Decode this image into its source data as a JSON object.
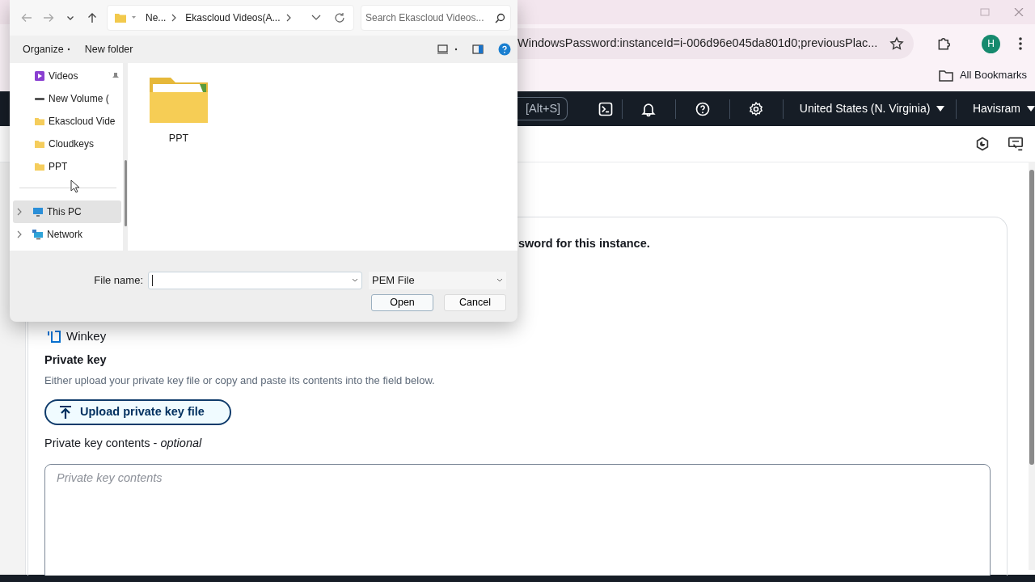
{
  "browser": {
    "address": "WindowsPassword:instanceId=i-006d96e045da801d0;previousPlac...",
    "profile_initial": "H",
    "bookmarks": [
      {
        "label": "All Bookmarks"
      }
    ]
  },
  "console_nav": {
    "search_shortcut": "[Alt+S]",
    "region": "United States (N. Virginia)",
    "account": "Havisram"
  },
  "page": {
    "instruction": "sword for this instance.",
    "key_pair": "Winkey",
    "private_key_title": "Private key",
    "private_key_description": "Either upload your private key file or copy and paste its contents into the field below.",
    "upload_button": "Upload private key file",
    "contents_label": "Private key contents - *optional*",
    "contents_placeholder": "Private key contents"
  },
  "dialog": {
    "nav_buttons": [
      {
        "kind": "back",
        "disabled": true
      },
      {
        "kind": "forward",
        "disabled": true
      },
      {
        "kind": "recent",
        "disabled": false
      },
      {
        "kind": "up",
        "disabled": false
      }
    ],
    "breadcrumb": [
      "Ne...",
      "Ekascloud Videos(A..."
    ],
    "search_placeholder": "Search Ekascloud Videos...",
    "organize": "Organize",
    "new_folder": "New folder",
    "nav_pane": [
      {
        "label": "Videos",
        "kind": "videos",
        "pinned": true,
        "expandable": false,
        "selected": false
      },
      {
        "label": "New Volume (",
        "kind": "drive",
        "pinned": false,
        "expandable": false,
        "selected": false
      },
      {
        "label": "Ekascloud Vide",
        "kind": "folder",
        "pinned": false,
        "expandable": false,
        "selected": false
      },
      {
        "label": "Cloudkeys",
        "kind": "folder",
        "pinned": false,
        "expandable": false,
        "selected": false
      },
      {
        "label": "PPT",
        "kind": "folder",
        "pinned": false,
        "expandable": false,
        "selected": false
      },
      {
        "label": "This PC",
        "kind": "pc",
        "pinned": false,
        "expandable": true,
        "selected": true
      },
      {
        "label": "Network",
        "kind": "network",
        "pinned": false,
        "expandable": true,
        "selected": false
      }
    ],
    "items": [
      {
        "label": "PPT",
        "kind": "folder"
      }
    ],
    "file_name_label": "File name:",
    "file_type": "PEM File",
    "buttons": [
      {
        "label": "Open",
        "default": true
      },
      {
        "label": "Cancel",
        "default": false
      }
    ]
  }
}
